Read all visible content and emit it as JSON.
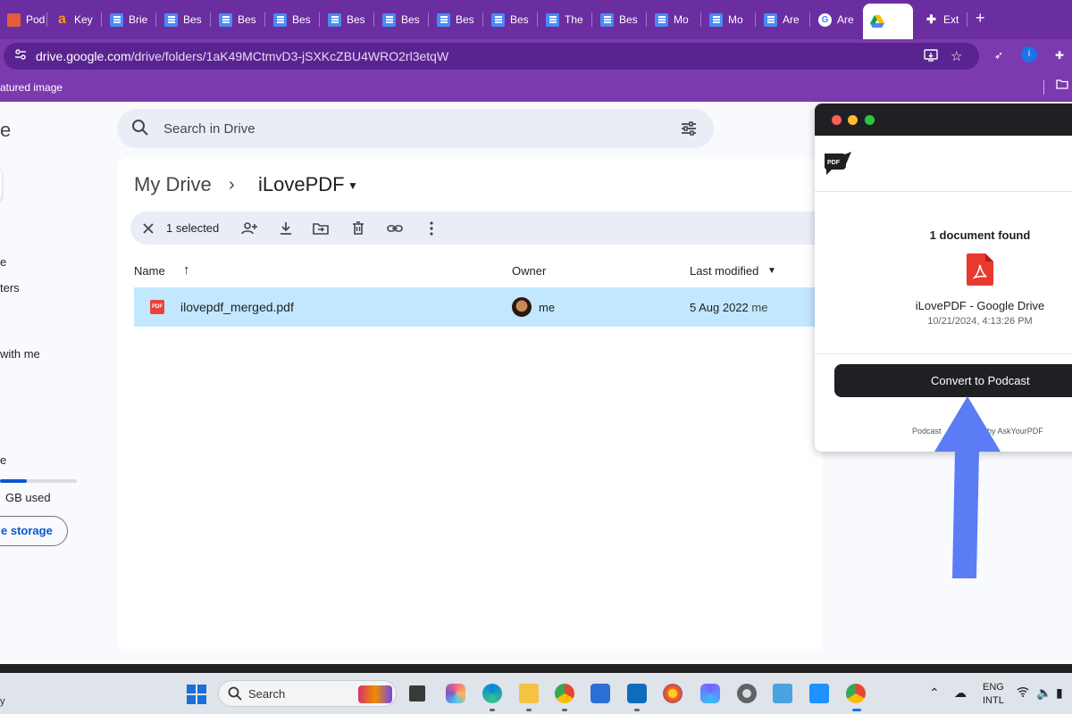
{
  "browser": {
    "tabs": [
      {
        "label": "Pod",
        "favicon": "podcast-icon"
      },
      {
        "label": "Key",
        "favicon": "amazon-icon"
      },
      {
        "label": "Brie",
        "favicon": "docs-icon"
      },
      {
        "label": "Bes",
        "favicon": "docs-icon"
      },
      {
        "label": "Bes",
        "favicon": "docs-icon"
      },
      {
        "label": "Bes",
        "favicon": "docs-icon"
      },
      {
        "label": "Bes",
        "favicon": "docs-icon"
      },
      {
        "label": "Bes",
        "favicon": "docs-icon"
      },
      {
        "label": "Bes",
        "favicon": "docs-icon"
      },
      {
        "label": "Bes",
        "favicon": "docs-icon"
      },
      {
        "label": "The",
        "favicon": "docs-icon"
      },
      {
        "label": "Bes",
        "favicon": "docs-icon"
      },
      {
        "label": "Mo",
        "favicon": "docs-icon"
      },
      {
        "label": "Mo",
        "favicon": "docs-icon"
      },
      {
        "label": "Are",
        "favicon": "docs-icon"
      },
      {
        "label": "Are",
        "favicon": "google-icon"
      },
      {
        "label": "",
        "favicon": "drive-icon",
        "active": true
      },
      {
        "label": "Ext",
        "favicon": "puzzle-icon"
      }
    ],
    "url_host": "drive.google.com",
    "url_path": "/drive/folders/1aK49MCtmvD3-jSXKcZBU4WRO2rl3etqW",
    "bookmark_text": "atured image"
  },
  "drive": {
    "logo_fragment": "e",
    "sidebar": {
      "item_a": "e",
      "item_b": "ters",
      "item_c": "with me",
      "storage_label": "e",
      "storage_used": "GB used",
      "storage_button": "e storage"
    },
    "search_placeholder": "Search in Drive",
    "breadcrumb": {
      "root": "My Drive",
      "separator": "›",
      "current": "iLovePDF"
    },
    "selection_text": "1 selected",
    "columns": {
      "name": "Name",
      "owner": "Owner",
      "last_modified": "Last modified"
    },
    "files": [
      {
        "icon_label": "PDF",
        "name": "ilovepdf_merged.pdf",
        "owner": "me",
        "modified_date": "5 Aug 2022",
        "modified_by": "me"
      }
    ]
  },
  "popup": {
    "doc_found": "1 document found",
    "doc_title": "iLovePDF - Google Drive",
    "doc_date": "10/21/2024, 4:13:26 PM",
    "convert_label": "Convert to Podcast",
    "powered_left": "Podcast",
    "powered_right": "by AskYourPDF",
    "logo_text": "PDF"
  },
  "taskbar": {
    "left_text": "y",
    "search_label": "Search",
    "lang_top": "ENG",
    "lang_bottom": "INTL"
  },
  "colors": {
    "chrome_purple": "#6a2ea1",
    "selected_row": "#c2e7ff",
    "annotation_arrow": "#5b7cf5",
    "popup_dark": "#1f2023"
  }
}
